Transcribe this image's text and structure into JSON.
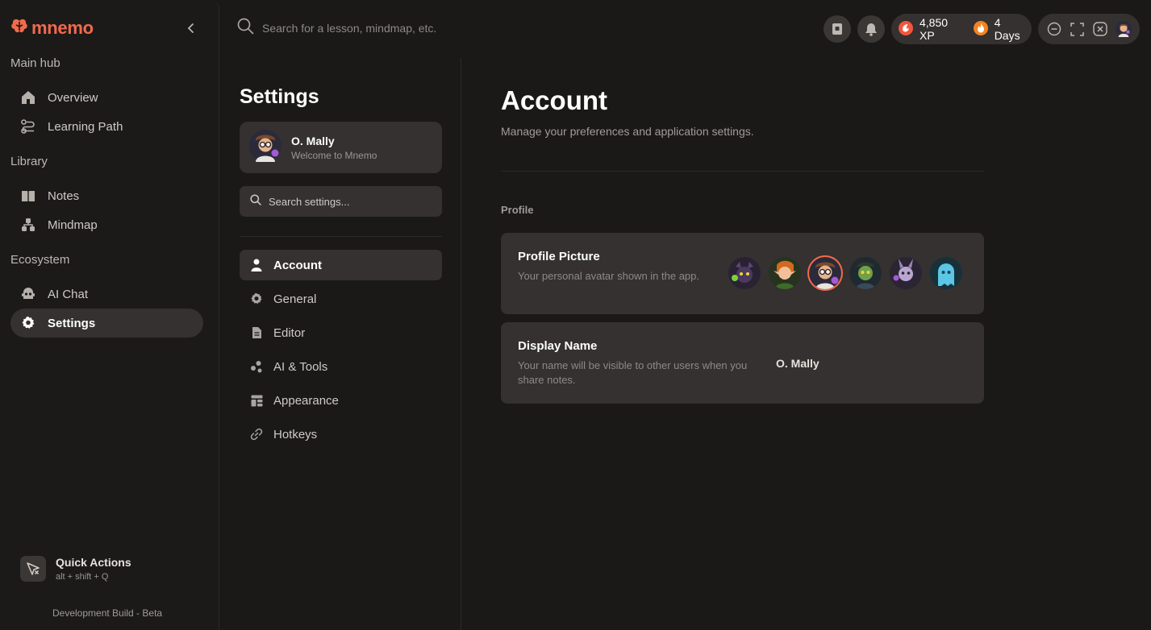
{
  "app": {
    "logo_text": "mnemo",
    "brand_color": "#f26a4b"
  },
  "sidebar": {
    "sections": [
      {
        "label": "Main hub",
        "items": [
          {
            "label": "Overview",
            "icon": "home-icon"
          },
          {
            "label": "Learning Path",
            "icon": "path-icon"
          }
        ]
      },
      {
        "label": "Library",
        "items": [
          {
            "label": "Notes",
            "icon": "book-icon"
          },
          {
            "label": "Mindmap",
            "icon": "mindmap-icon"
          }
        ]
      },
      {
        "label": "Ecosystem",
        "items": [
          {
            "label": "AI Chat",
            "icon": "robot-icon"
          },
          {
            "label": "Settings",
            "icon": "gear-icon",
            "active": true
          }
        ]
      }
    ],
    "quick_actions": {
      "title": "Quick Actions",
      "shortcut": "alt + shift + Q"
    },
    "build_label": "Development Build - Beta"
  },
  "topbar": {
    "search_placeholder": "Search for a lesson, mindmap, etc.",
    "xp": "4,850 XP",
    "streak": "4 Days"
  },
  "settings": {
    "title": "Settings",
    "user": {
      "name": "O. Mally",
      "subtitle": "Welcome to Mnemo"
    },
    "search_placeholder": "Search settings...",
    "nav": [
      {
        "label": "Account",
        "icon": "user-icon",
        "active": true
      },
      {
        "label": "General",
        "icon": "gear-icon"
      },
      {
        "label": "Editor",
        "icon": "document-icon"
      },
      {
        "label": "AI & Tools",
        "icon": "molecule-icon"
      },
      {
        "label": "Appearance",
        "icon": "layout-icon"
      },
      {
        "label": "Hotkeys",
        "icon": "link-icon"
      }
    ]
  },
  "main": {
    "title": "Account",
    "subtitle": "Manage your preferences and application settings.",
    "group_label": "Profile",
    "profile_picture": {
      "title": "Profile Picture",
      "description": "Your personal avatar shown in the app.",
      "avatars": [
        "dark-creature",
        "elf",
        "scientist",
        "zombie",
        "bunny",
        "ghost"
      ],
      "selected_index": 2
    },
    "display_name": {
      "title": "Display Name",
      "description": "Your name will be visible to other users when you share notes.",
      "value": "O. Mally"
    }
  }
}
